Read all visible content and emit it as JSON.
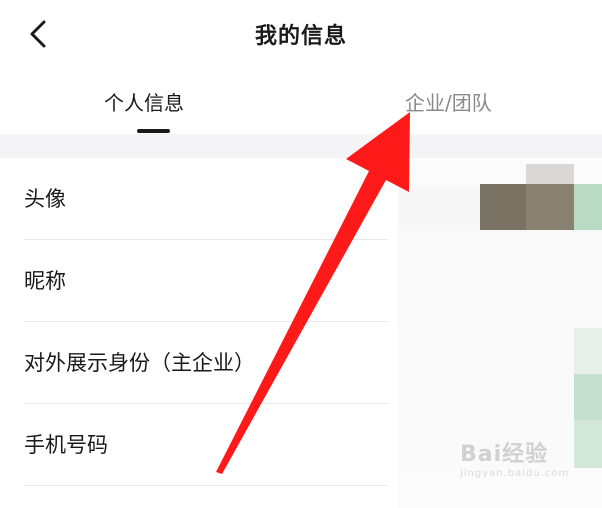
{
  "header": {
    "title": "我的信息",
    "back_icon": "chevron-left-icon"
  },
  "tabs": [
    {
      "label": "个人信息",
      "active": true
    },
    {
      "label": "企业/团队",
      "active": false
    }
  ],
  "rows": [
    {
      "label": "头像"
    },
    {
      "label": "昵称"
    },
    {
      "label": "对外展示身份（主企业）"
    },
    {
      "label": "手机号码"
    }
  ],
  "annotation": {
    "arrow_color": "#ff1a1a"
  },
  "watermark": {
    "brand": "Bai经验",
    "url": "jingyan.baidu.com"
  }
}
